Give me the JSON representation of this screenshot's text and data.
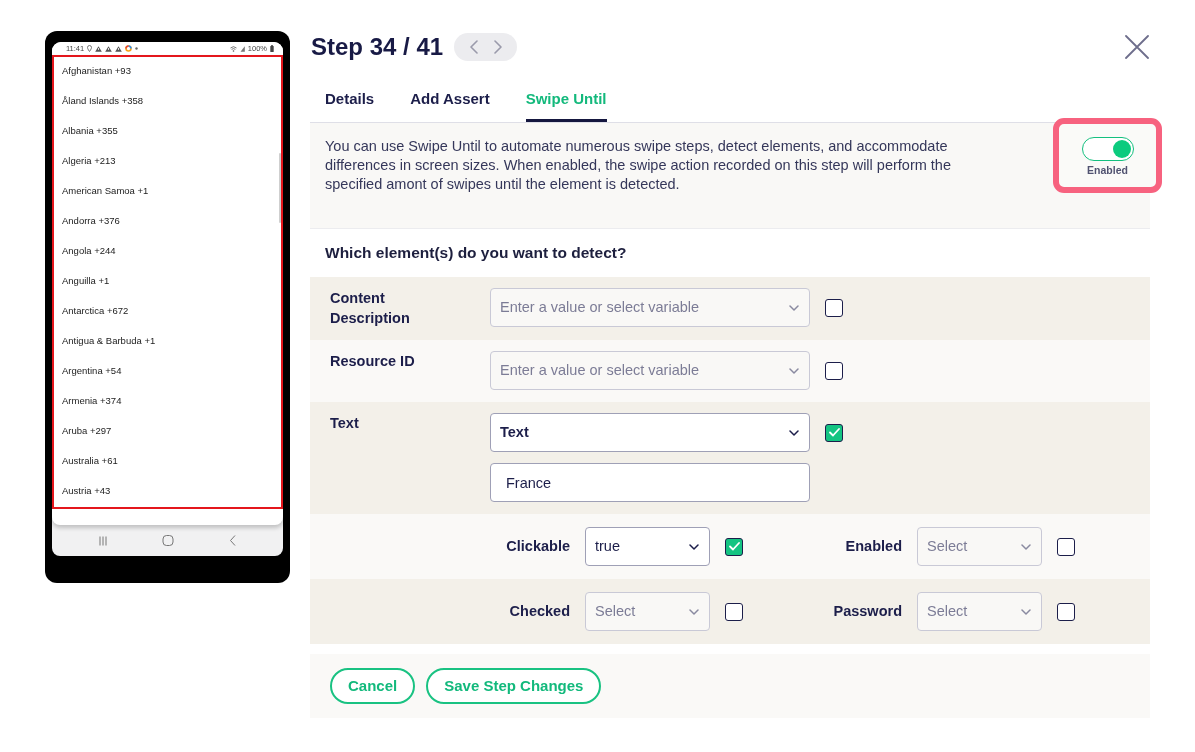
{
  "device_preview": {
    "status_bar": {
      "time": "11:41",
      "battery": "100%"
    },
    "list_items": [
      "Afghanistan +93",
      "Åland Islands +358",
      "Albania +355",
      "Algeria +213",
      "American Samoa +1",
      "Andorra +376",
      "Angola +244",
      "Anguilla +1",
      "Antarctica +672",
      "Antigua & Barbuda +1",
      "Argentina +54",
      "Armenia +374",
      "Aruba +297",
      "Australia +61",
      "Austria +43"
    ]
  },
  "step_header": {
    "title": "Step 34 / 41"
  },
  "tabs": [
    {
      "label": "Details",
      "selected": false
    },
    {
      "label": "Add Assert",
      "selected": false
    },
    {
      "label": "Swipe Until",
      "selected": true
    }
  ],
  "swipe_until": {
    "description": "You can use Swipe Until to automate numerous swipe steps, detect elements, and accommodate differences in screen sizes. When enabled, the swipe action recorded on this step will perform the specified amont of swipes until the element is detected.",
    "toggle": {
      "on": true,
      "label": "Enabled"
    }
  },
  "detect": {
    "heading": "Which element(s) do you want to detect?",
    "fields": [
      {
        "label": "Content Description",
        "placeholder": "Enter a value or select variable",
        "checked": false
      },
      {
        "label": "Resource ID",
        "placeholder": "Enter a value or select variable",
        "checked": false
      },
      {
        "label": "Text",
        "value": "Text",
        "checked": true,
        "text_input": {
          "value": "France"
        }
      }
    ],
    "property_rows": [
      {
        "items": [
          {
            "label": "Clickable",
            "value": "true",
            "checked": true
          },
          {
            "label": "Enabled",
            "placeholder": "Select",
            "checked": false
          }
        ]
      },
      {
        "items": [
          {
            "label": "Checked",
            "placeholder": "Select",
            "checked": false
          },
          {
            "label": "Password",
            "placeholder": "Select",
            "checked": false
          }
        ]
      }
    ]
  },
  "buttons": [
    {
      "label": "Cancel"
    },
    {
      "label": "Save Step Changes"
    }
  ]
}
